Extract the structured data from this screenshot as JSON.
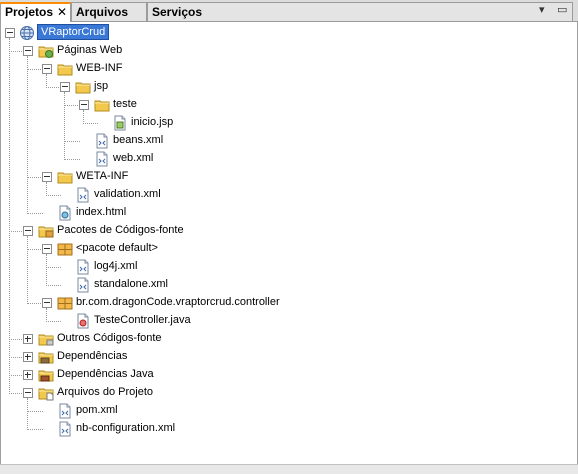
{
  "tabs": [
    {
      "label": "Projetos",
      "active": true,
      "close": "✕"
    },
    {
      "label": "Arquivos",
      "active": false
    },
    {
      "label": "Serviços",
      "active": false
    }
  ],
  "window_controls": {
    "dropdown": "▾",
    "restore": "▭"
  },
  "tree": [
    {
      "id": "n0",
      "label": "VRaptorCrud",
      "icon": "project-globe-icon",
      "selected": true,
      "expander": "minus"
    },
    {
      "id": "n1",
      "label": "Páginas Web",
      "icon": "web-pages-folder-icon",
      "expander": "minus"
    },
    {
      "id": "n2",
      "label": "WEB-INF",
      "icon": "folder-icon",
      "expander": "minus"
    },
    {
      "id": "n3",
      "label": "jsp",
      "icon": "folder-icon",
      "expander": "minus"
    },
    {
      "id": "n4",
      "label": "teste",
      "icon": "folder-icon",
      "expander": "minus"
    },
    {
      "id": "n5",
      "label": "inicio.jsp",
      "icon": "jsp-file-icon"
    },
    {
      "id": "n6",
      "label": "beans.xml",
      "icon": "xml-file-icon"
    },
    {
      "id": "n7",
      "label": "web.xml",
      "icon": "xml-file-icon"
    },
    {
      "id": "n8",
      "label": "WETA-INF",
      "icon": "folder-icon",
      "expander": "minus"
    },
    {
      "id": "n9",
      "label": "validation.xml",
      "icon": "xml-file-icon"
    },
    {
      "id": "n10",
      "label": "index.html",
      "icon": "html-file-icon"
    },
    {
      "id": "n11",
      "label": "Pacotes de Códigos-fonte",
      "icon": "source-packages-icon",
      "expander": "minus"
    },
    {
      "id": "n12",
      "label": "<pacote default>",
      "icon": "package-icon",
      "expander": "minus"
    },
    {
      "id": "n13",
      "label": "log4j.xml",
      "icon": "xml-file-icon"
    },
    {
      "id": "n14",
      "label": "standalone.xml",
      "icon": "xml-file-icon"
    },
    {
      "id": "n15",
      "label": "br.com.dragonCode.vraptorcrud.controller",
      "icon": "package-icon",
      "expander": "minus"
    },
    {
      "id": "n16",
      "label": "TesteController.java",
      "icon": "java-file-icon"
    },
    {
      "id": "n17",
      "label": "Outros Códigos-fonte",
      "icon": "other-sources-icon",
      "expander": "plus"
    },
    {
      "id": "n18",
      "label": "Dependências",
      "icon": "dependencies-icon",
      "expander": "plus"
    },
    {
      "id": "n19",
      "label": "Dependências Java",
      "icon": "java-dependencies-icon",
      "expander": "plus"
    },
    {
      "id": "n20",
      "label": "Arquivos do Projeto",
      "icon": "project-files-icon",
      "expander": "minus"
    },
    {
      "id": "n21",
      "label": "pom.xml",
      "icon": "xml-file-icon"
    },
    {
      "id": "n22",
      "label": "nb-configuration.xml",
      "icon": "xml-file-icon"
    }
  ],
  "colors": {
    "selection": "#3a78d8",
    "tab_accent": "#ff8c00",
    "folder": "#f2c94c",
    "package": "#e0a040"
  }
}
